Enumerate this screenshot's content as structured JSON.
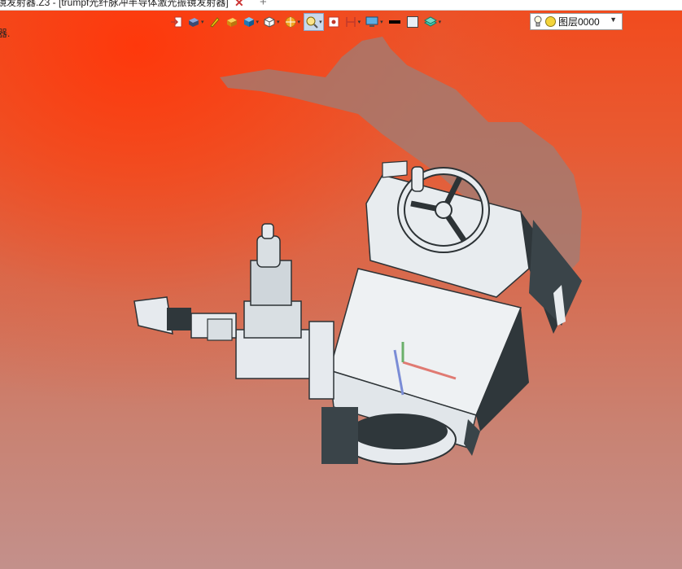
{
  "window": {
    "tab_title": "镜发射器.Z3 - [trumpf光纤脉冲半导体激光振镜发射器]",
    "close_glyph": "✕",
    "add_glyph": "+",
    "side_fragment": "器."
  },
  "toolbar": {
    "items": [
      {
        "icon": "exit-sketch-icon"
      },
      {
        "icon": "view-style-icon",
        "dropdown": true
      },
      {
        "icon": "pen-icon"
      },
      {
        "icon": "box-yellow-icon"
      },
      {
        "icon": "shaded-cube-icon",
        "dropdown": true
      },
      {
        "icon": "wire-cube-icon",
        "dropdown": true
      },
      {
        "icon": "section-icon",
        "dropdown": true
      },
      {
        "icon": "zoom-icon",
        "dropdown": true
      },
      {
        "icon": "snap-icon"
      },
      {
        "icon": "dimension-icon",
        "dropdown": true
      },
      {
        "icon": "display-icon",
        "dropdown": true
      },
      {
        "icon": "line-color-icon"
      },
      {
        "icon": "fill-color-icon"
      },
      {
        "icon": "layer-icon",
        "dropdown": true
      }
    ],
    "layer": {
      "name": "图层0000",
      "status_color": "#f4d43a"
    }
  },
  "colors": {
    "background_top": "#f24a1c",
    "background_bottom": "#c3908b",
    "part": "#e6eaee",
    "part_dark": "#323a3e"
  }
}
